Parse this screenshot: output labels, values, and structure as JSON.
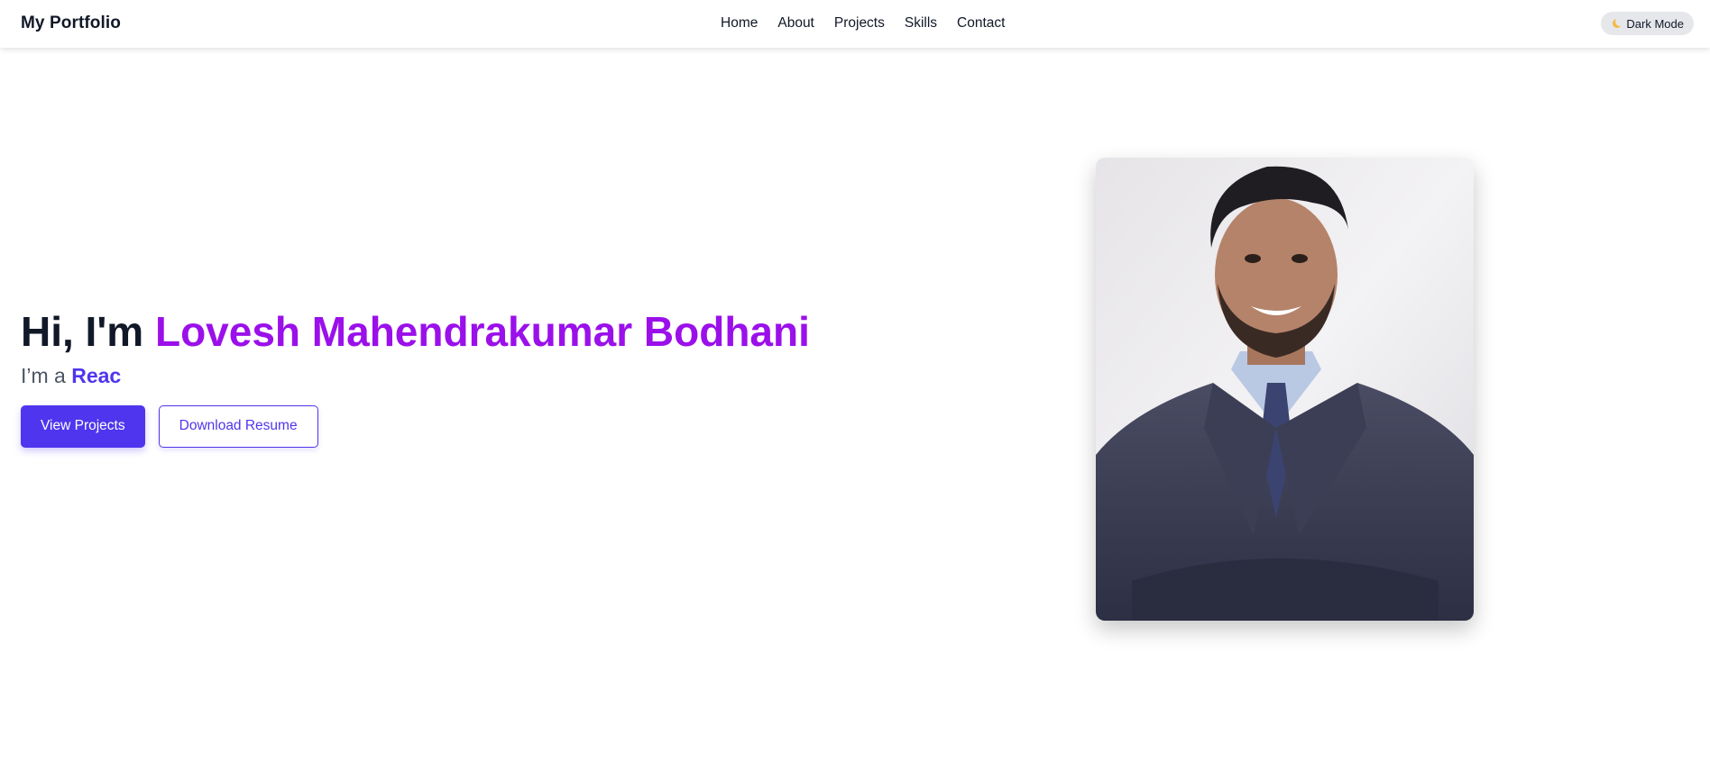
{
  "navbar": {
    "brand": "My Portfolio",
    "links": [
      "Home",
      "About",
      "Projects",
      "Skills",
      "Contact"
    ],
    "dark_mode_label": "Dark Mode",
    "dark_mode_icon": "moon-icon"
  },
  "hero": {
    "greeting": "Hi, I'm ",
    "name": "Lovesh Mahendrakumar Bodhani",
    "role_prefix": "I’m a ",
    "role_typed": "Reac",
    "primary_button": "View Projects",
    "secondary_button": "Download Resume"
  },
  "colors": {
    "accent": "#4f35ee",
    "name_purple": "#9b10ea",
    "text_dark": "#111827",
    "toggle_bg": "#e5e7eb"
  }
}
